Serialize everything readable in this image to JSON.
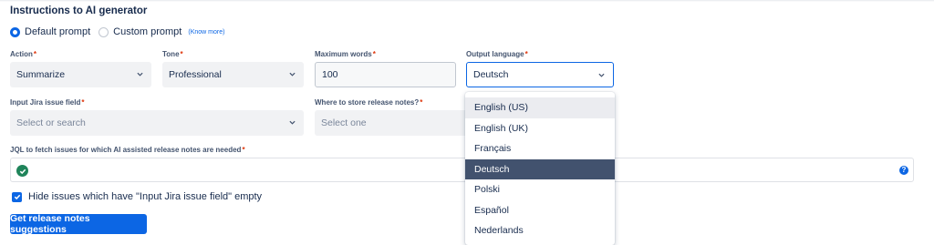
{
  "form": {
    "title": "Instructions to AI generator",
    "prompt_options": [
      "Default prompt",
      "Custom prompt"
    ],
    "know_more": "(Know more)",
    "action": {
      "label": "Action",
      "value": "Summarize"
    },
    "tone": {
      "label": "Tone",
      "value": "Professional"
    },
    "max_words": {
      "label": "Maximum words",
      "value": "100"
    },
    "output_language": {
      "label": "Output language",
      "value": "Deutsch"
    },
    "jira_field": {
      "label": "Input Jira issue field",
      "placeholder": "Select or search"
    },
    "store_notes": {
      "label": "Where to store release notes?",
      "placeholder": "Select one"
    },
    "jql": {
      "label": "JQL to fetch issues for which AI assisted release notes are needed",
      "help_icon": "?"
    },
    "hide_empty_label": "Hide issues which have \"Input Jira issue field\" empty",
    "submit_label": "Get release notes suggestions",
    "required_mark": "*"
  },
  "language_options": [
    "English (US)",
    "English (UK)",
    "Français",
    "Deutsch",
    "Polski",
    "Español",
    "Nederlands"
  ],
  "colors": {
    "accent": "#0c66e4",
    "selected_option": "#42526e",
    "success": "#1f845a",
    "required": "#de350b"
  },
  "icons": {
    "dropdown": "chevron-down-icon",
    "valid": "check-circle-icon",
    "help": "question-circle-icon",
    "checkbox": "checkmark-icon"
  }
}
